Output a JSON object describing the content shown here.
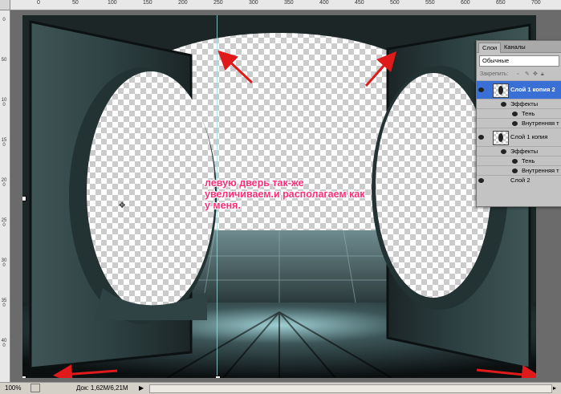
{
  "ruler": {
    "top_labels": [
      "50",
      "0",
      "50",
      "100",
      "150",
      "200",
      "250",
      "300",
      "350",
      "400",
      "450",
      "500",
      "550",
      "600",
      "650",
      "700"
    ],
    "left_labels": [
      "0",
      "50",
      "100",
      "150",
      "200",
      "250",
      "300",
      "350",
      "400"
    ]
  },
  "annotation": {
    "lines": [
      "левую дверь так-же",
      "увеличиваем.и располагаем как",
      "у меня."
    ],
    "color": "#ff2d78"
  },
  "arrows_color": "#e01a1a",
  "layers_panel": {
    "tabs": [
      "Слои",
      "Каналы"
    ],
    "active_tab": "Слои",
    "blend_mode": "Обычные",
    "lock_label": "Закрепить:",
    "layers": [
      {
        "name": "Слой 1 копия 2",
        "selected": true,
        "effects_label": "Эффекты",
        "effects": [
          "Тень",
          "Внутренняя т"
        ]
      },
      {
        "name": "Слой 1 копия",
        "selected": false,
        "effects_label": "Эффекты",
        "effects": [
          "Тень",
          "Внутренняя т"
        ]
      },
      {
        "name": "Слой 2",
        "selected": false
      }
    ]
  },
  "status_bar": {
    "zoom": "100%",
    "doc_info": "Док: 1,62М/6,21М"
  },
  "icons": [
    "eye-icon",
    "fx-icon",
    "lock-icon",
    "brush-icon",
    "move-icon",
    "play-icon",
    "scroll-left-icon",
    "scroll-right-icon"
  ]
}
